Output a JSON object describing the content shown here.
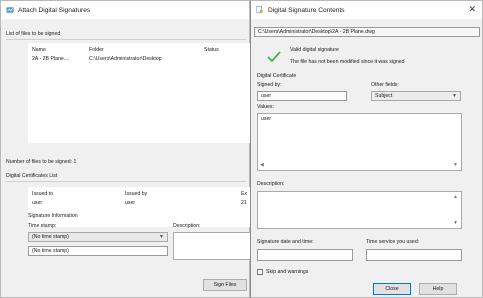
{
  "left_window": {
    "title": "Attach Digital Signatures",
    "files_section_label": "List of files to be signed",
    "files_columns": [
      "Name",
      "Folder",
      "Status"
    ],
    "files_rows": [
      {
        "name": "2A - 2B Plane....",
        "folder": "C:\\Users\\Administrator\\Desktop",
        "status": ""
      }
    ],
    "files_count_label": "Number of files to be signed: 1",
    "certs_label": "Digital Certificates List",
    "certs_columns": [
      "Issued to",
      "Issued by",
      "Ex"
    ],
    "certs_rows": [
      {
        "issued_to": "user",
        "issued_by": "user",
        "expires": "21"
      }
    ],
    "sig_info_label": "Signature Information",
    "time_stamp_label": "Time stamp:",
    "time_stamp_value": "(No time stamp)",
    "time_stamp_field": "(No time stamp)",
    "description_label": "Description:",
    "sign_button": "Sign Files"
  },
  "right_window": {
    "title": "Digital Signature Contents",
    "path": "C:\\Users\\Administrator\\Desktop\\2A - 2B Plane.dwg",
    "valid_text": "Valid digital signature",
    "not_modified_text": "The file has not been modified since it was signed",
    "digital_certificate_label": "Digital Certificate",
    "signed_by_label": "Signed by:",
    "signed_by_value": "user",
    "other_fields_label": "Other fields:",
    "other_fields_value": "Subject",
    "values_label": "Values:",
    "values_value": "user",
    "description_label": "Description:",
    "sig_date_label": "Signature date and time:",
    "time_service_label": "Time service you used:",
    "skip_warnings_label": "Skip and warnings",
    "close_button": "Close",
    "help_button": "Help"
  },
  "colors": {
    "accent_blue": "#0078d7",
    "check_green": "#3cb44b",
    "window_bg": "#f0f0f0"
  }
}
